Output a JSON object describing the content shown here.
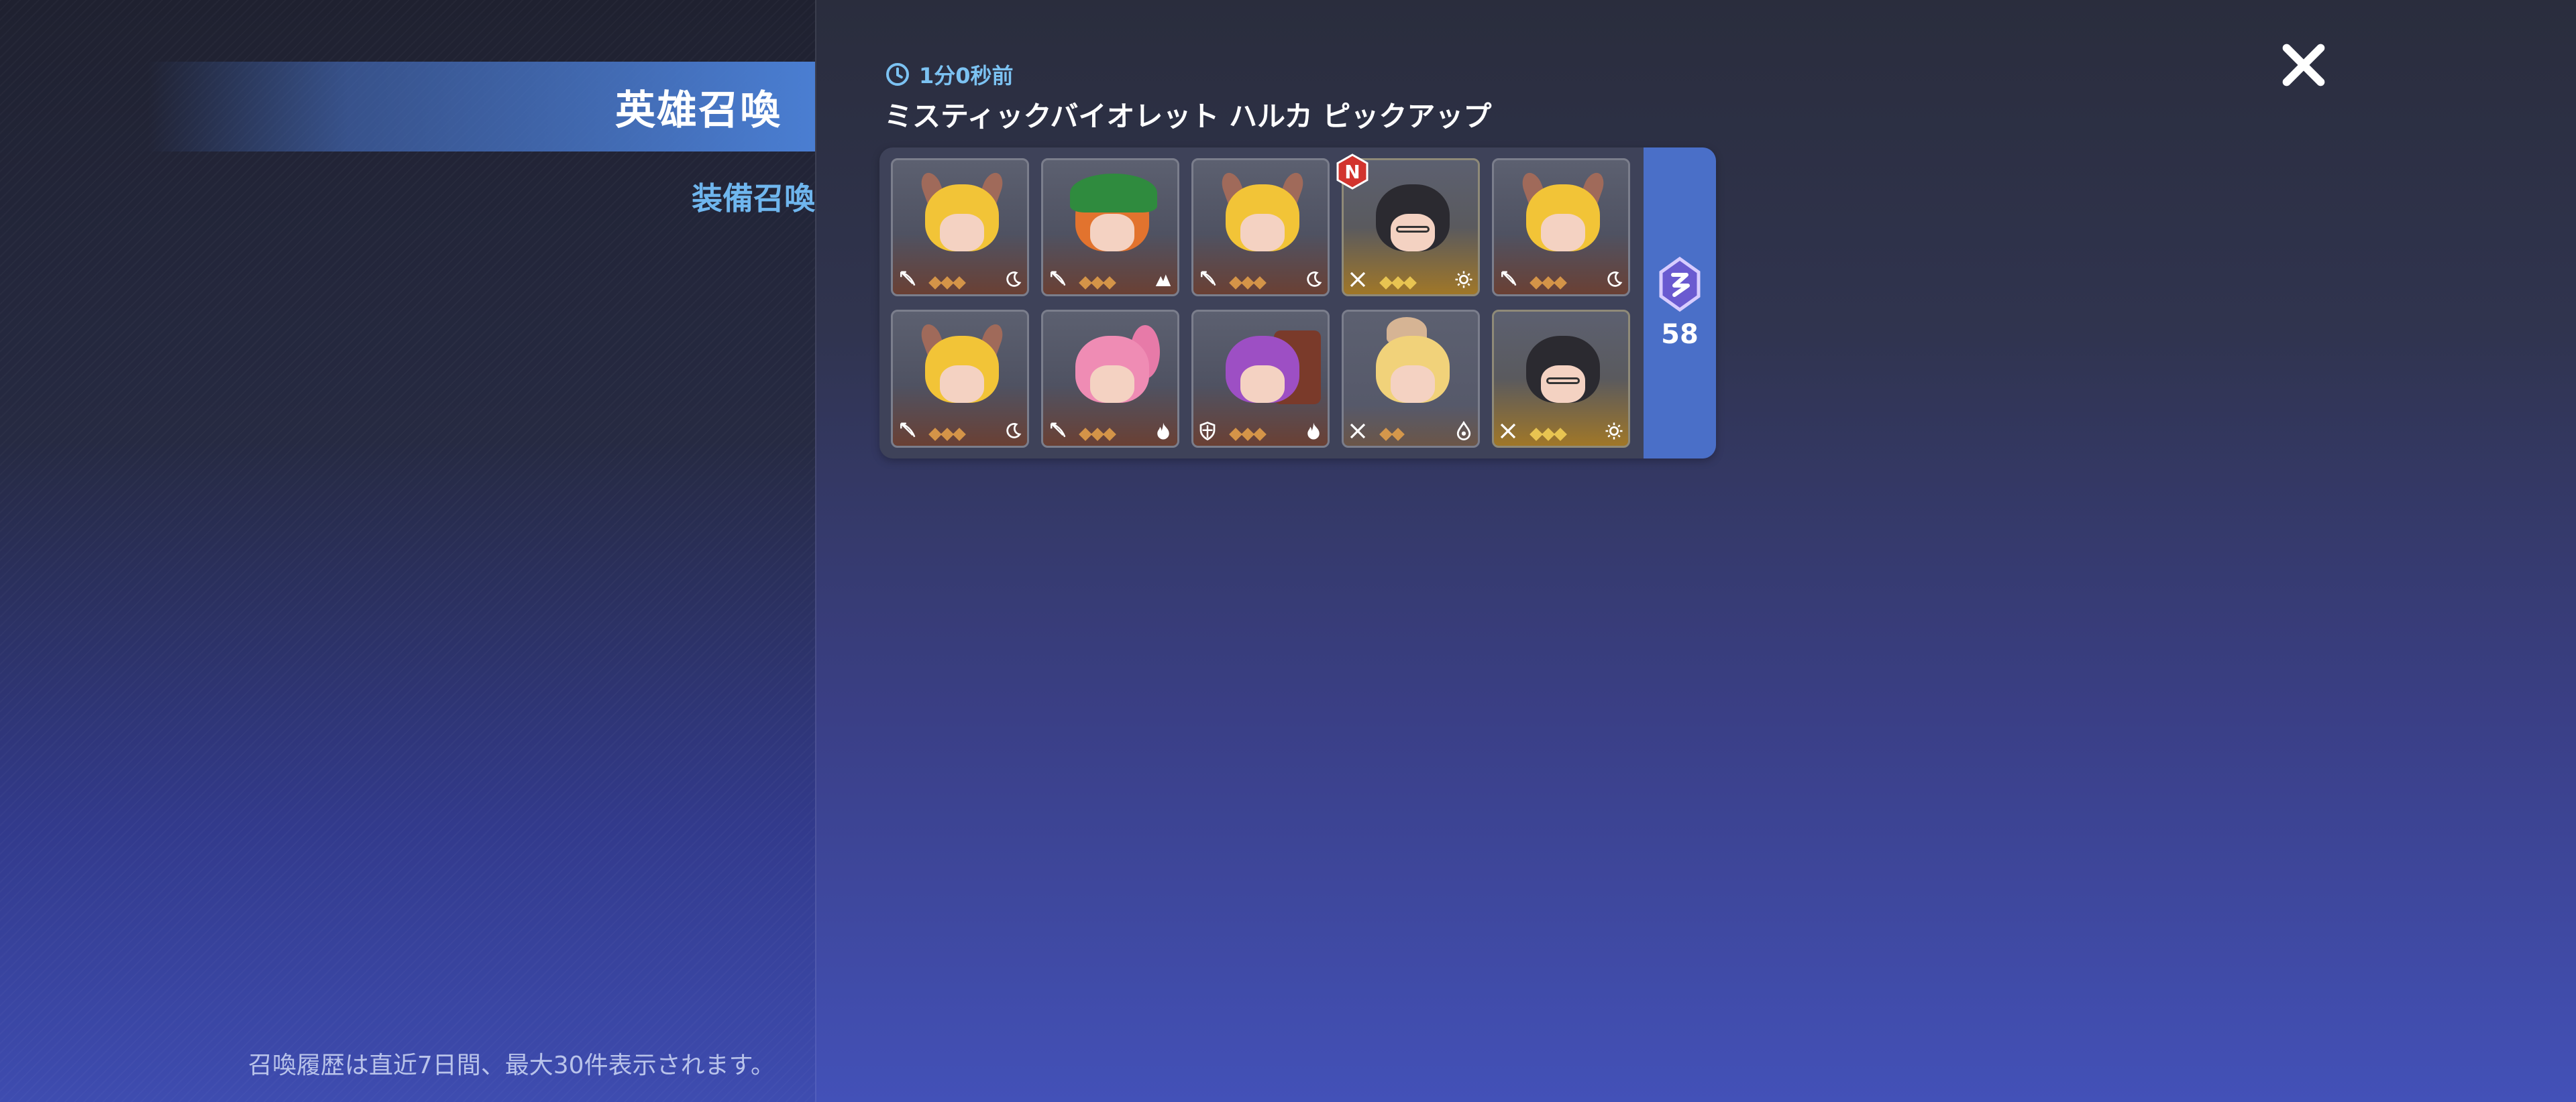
{
  "sidebar": {
    "tabs": [
      {
        "label": "英雄召喚",
        "active": true
      },
      {
        "label": "装備召喚",
        "active": false
      }
    ],
    "footer_note": "召喚履歴は直近7日間、最大30件表示されます。"
  },
  "history": {
    "time_ago": "1分0秒前",
    "banner_title": "ミスティックバイオレット ハルカ ピックアップ",
    "cost_count": "58",
    "new_badge": "N",
    "results": [
      {
        "name": "demon-horned-blonde-hero",
        "class_icon": "bow-icon",
        "element_icon": "moon-icon",
        "rarity": "normal"
      },
      {
        "name": "green-cap-orange-hair-hero",
        "class_icon": "bow-icon",
        "element_icon": "earth-icon",
        "rarity": "normal"
      },
      {
        "name": "demon-horned-blonde-hero",
        "class_icon": "bow-icon",
        "element_icon": "moon-icon",
        "rarity": "normal"
      },
      {
        "name": "glasses-dark-hair-hero",
        "class_icon": "swords-icon",
        "element_icon": "sun-icon",
        "rarity": "gold",
        "is_new": true
      },
      {
        "name": "demon-horned-blonde-hero",
        "class_icon": "bow-icon",
        "element_icon": "moon-icon",
        "rarity": "normal"
      },
      {
        "name": "demon-horned-blonde-hero",
        "class_icon": "bow-icon",
        "element_icon": "moon-icon",
        "rarity": "normal"
      },
      {
        "name": "pink-ponytail-hero",
        "class_icon": "bow-icon",
        "element_icon": "fire-icon",
        "rarity": "normal"
      },
      {
        "name": "purple-hair-backpack-hero",
        "class_icon": "shield-icon",
        "element_icon": "fire-icon",
        "rarity": "normal"
      },
      {
        "name": "blonde-beast-ears-hero",
        "class_icon": "swords-icon",
        "element_icon": "water-icon",
        "rarity": "plain"
      },
      {
        "name": "glasses-dark-hair-hero",
        "class_icon": "swords-icon",
        "element_icon": "sun-icon",
        "rarity": "gold"
      }
    ]
  },
  "colors": {
    "accent_blue": "#4a7ed2",
    "time_text": "#7cc2f2",
    "new_badge": "#d2342e"
  }
}
